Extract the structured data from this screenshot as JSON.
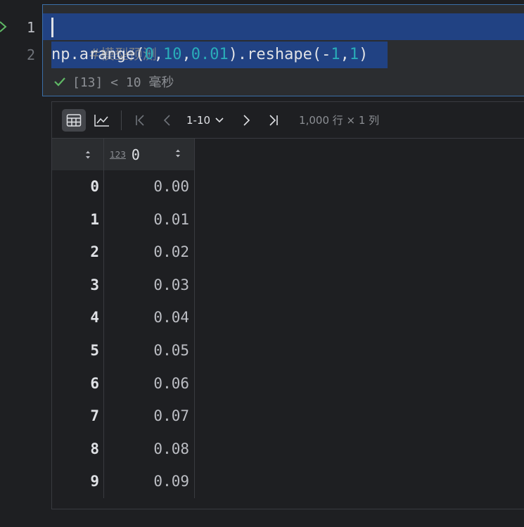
{
  "gutter": {
    "line1": "1",
    "line2": "2"
  },
  "code": {
    "comment": "#模型预测",
    "line2": [
      {
        "t": "np.arange(",
        "c": "code"
      },
      {
        "t": "0",
        "c": "num"
      },
      {
        "t": ",",
        "c": "code"
      },
      {
        "t": "10",
        "c": "num"
      },
      {
        "t": ",",
        "c": "code"
      },
      {
        "t": "0.01",
        "c": "num"
      },
      {
        "t": ").reshape(-",
        "c": "code"
      },
      {
        "t": "1",
        "c": "num"
      },
      {
        "t": ",",
        "c": "code"
      },
      {
        "t": "1",
        "c": "num"
      },
      {
        "t": ")",
        "c": "code"
      }
    ]
  },
  "status": {
    "text": "[13] < 10 毫秒"
  },
  "toolbar": {
    "page_range": "1-10",
    "rows_info": "1,000 行 × 1 列"
  },
  "table": {
    "type_badge": "123",
    "column": "0",
    "rows": [
      {
        "index": "0",
        "value": "0.00"
      },
      {
        "index": "1",
        "value": "0.01"
      },
      {
        "index": "2",
        "value": "0.02"
      },
      {
        "index": "3",
        "value": "0.03"
      },
      {
        "index": "4",
        "value": "0.04"
      },
      {
        "index": "5",
        "value": "0.05"
      },
      {
        "index": "6",
        "value": "0.06"
      },
      {
        "index": "7",
        "value": "0.07"
      },
      {
        "index": "8",
        "value": "0.08"
      },
      {
        "index": "9",
        "value": "0.09"
      }
    ]
  },
  "colors": {
    "selection": "#214283",
    "number": "#2aacb8",
    "success": "#5fb865"
  }
}
